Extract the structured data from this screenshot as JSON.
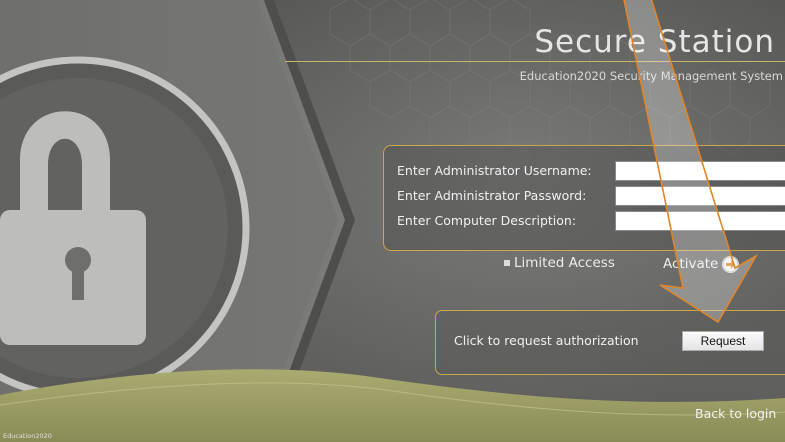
{
  "header": {
    "title": "Secure Station",
    "subtitle": "Education2020 Security Management System"
  },
  "login_form": {
    "fields": [
      {
        "label": "Enter Administrator Username:",
        "value": ""
      },
      {
        "label": "Enter Administrator Password:",
        "value": ""
      },
      {
        "label": "Enter Computer Description:",
        "value": ""
      }
    ],
    "limited_access_label": "Limited Access",
    "activate_label": "Activate"
  },
  "request": {
    "label": "Click to request authorization",
    "button_label": "Request"
  },
  "footer": {
    "back_link": "Back to login",
    "brand": "Education2020"
  },
  "icons": {
    "lock": "lock-icon",
    "activate_arrow": "arrow-right-circle-icon",
    "annotation_arrow": "annotation-arrow-icon"
  },
  "colors": {
    "accent_border": "#c9a64f",
    "annotation_arrow": "#e0862a",
    "lock_fill": "#bcbcbc",
    "hill": "#9ea167"
  }
}
